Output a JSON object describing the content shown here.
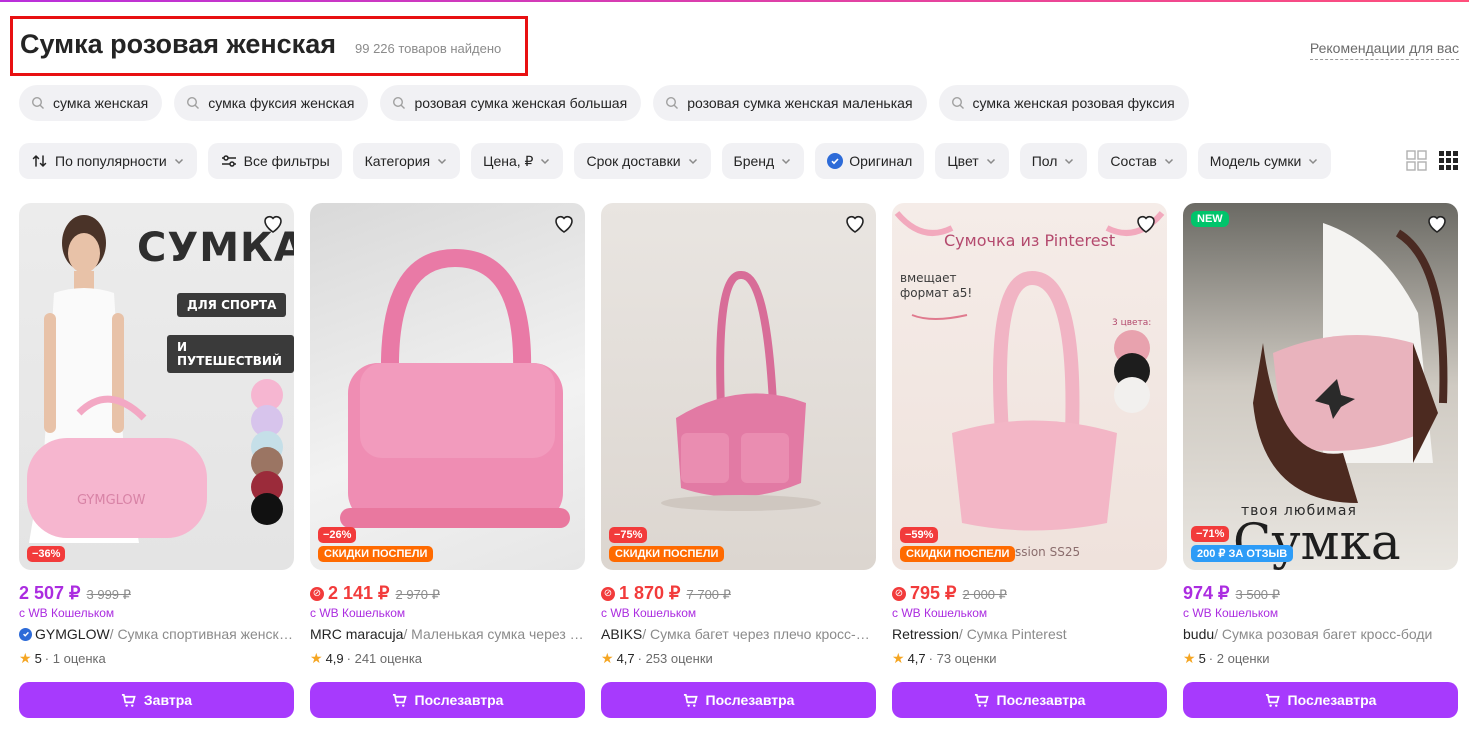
{
  "header": {
    "title": "Сумка розовая женская",
    "count": "99 226 товаров найдено",
    "recommendations": "Рекомендации для вас"
  },
  "suggestions": [
    "сумка женская",
    "сумка фуксия женская",
    "розовая сумка женская большая",
    "розовая сумка женская маленькая",
    "сумка женская розовая фуксия"
  ],
  "filters": {
    "sort": "По популярности",
    "all_filters": "Все фильтры",
    "category": "Категория",
    "price": "Цена, ₽",
    "delivery": "Срок доставки",
    "brand": "Бренд",
    "original": "Оригинал",
    "color": "Цвет",
    "gender": "Пол",
    "composition": "Состав",
    "model": "Модель сумки"
  },
  "products": [
    {
      "price": "2 507 ₽",
      "old_price": "3 999 ₽",
      "wallet": "с WB Кошельком",
      "brand": "GYMGLOW",
      "desc": " / Сумка спортивная женская",
      "rating": "5",
      "reviews": "1 оценка",
      "discount": "−36%",
      "promo": "",
      "button": "Завтра",
      "image_text_1": "СУМКА",
      "image_text_2": "ДЛЯ СПОРТА",
      "image_text_3": "И ПУТЕШЕСТВИЙ",
      "image_text_4": "GYMGLOW"
    },
    {
      "price": "2 141 ₽",
      "old_price": "2 970 ₽",
      "wallet": "с WB Кошельком",
      "brand": "MRC maracuja",
      "desc": " / Маленькая сумка через плечо",
      "rating": "4,9",
      "reviews": "241 оценка",
      "discount": "−26%",
      "promo": "СКИДКИ ПОСПЕЛИ",
      "button": "Послезавтра"
    },
    {
      "price": "1 870 ₽",
      "old_price": "7 700 ₽",
      "wallet": "с WB Кошельком",
      "brand": "ABIKS",
      "desc": " / Сумка багет через плечо кросс-боди",
      "rating": "4,7",
      "reviews": "253 оценки",
      "discount": "−75%",
      "promo": "СКИДКИ ПОСПЕЛИ",
      "button": "Послезавтра"
    },
    {
      "price": "795 ₽",
      "old_price": "2 000 ₽",
      "wallet": "с WB Кошельком",
      "brand": "Retression",
      "desc": " / Сумка Pinterest",
      "rating": "4,7",
      "reviews": "73 оценки",
      "discount": "−59%",
      "promo": "СКИДКИ ПОСПЕЛИ",
      "button": "Послезавтра",
      "image_text_1": "Сумочка из Pinterest",
      "image_text_2": "вмещает формат а5!",
      "image_text_3": "3 цвета:",
      "image_text_4": "ssion SS25"
    },
    {
      "price": "974 ₽",
      "old_price": "3 500 ₽",
      "wallet": "с WB Кошельком",
      "brand": "budu",
      "desc": " / Сумка розовая багет кросс-боди",
      "rating": "5",
      "reviews": "2 оценки",
      "discount": "−71%",
      "promo": "200 ₽ ЗА ОТЗЫВ",
      "new_label": "NEW",
      "button": "Послезавтра",
      "image_text_1": "твоя любимая",
      "image_text_2": "Сумка"
    }
  ]
}
